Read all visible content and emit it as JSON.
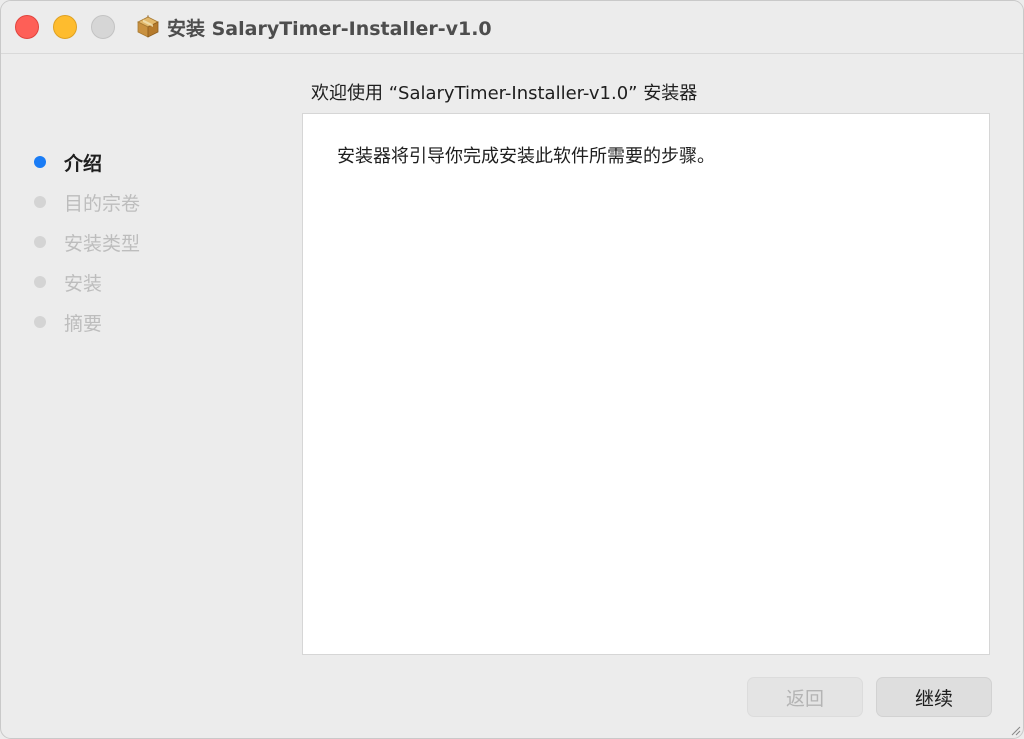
{
  "window": {
    "title": "安装 SalaryTimer-Installer-v1.0",
    "icon": "package-icon"
  },
  "main": {
    "heading": "欢迎使用 “SalaryTimer-Installer-v1.0” 安装器",
    "body_text": "安装器将引导你完成安装此软件所需要的步骤。"
  },
  "sidebar": {
    "steps": [
      {
        "label": "介绍",
        "active": true
      },
      {
        "label": "目的宗卷",
        "active": false
      },
      {
        "label": "安装类型",
        "active": false
      },
      {
        "label": "安装",
        "active": false
      },
      {
        "label": "摘要",
        "active": false
      }
    ]
  },
  "footer": {
    "back_label": "返回",
    "continue_label": "继续"
  },
  "colors": {
    "accent": "#1a7cf5",
    "close": "#fe5f57",
    "minimize": "#febc2e",
    "zoom": "#d6d6d6"
  }
}
